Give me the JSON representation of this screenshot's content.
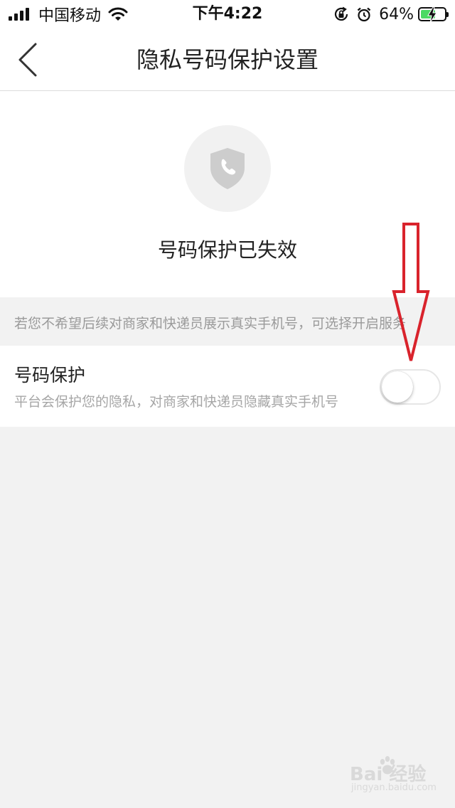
{
  "status_bar": {
    "carrier": "中国移动",
    "time": "下午4:22",
    "battery_percent": "64%",
    "battery_level": 0.64,
    "signal_bars": 4,
    "icons": [
      "signal-icon",
      "wifi-icon",
      "rotation-lock-icon",
      "alarm-icon",
      "battery-charging-icon"
    ]
  },
  "nav": {
    "title": "隐私号码保护设置",
    "back_icon": "chevron-left-icon"
  },
  "status_section": {
    "icon": "shield-phone-icon",
    "text": "号码保护已失效"
  },
  "hint": {
    "text": "若您不希望后续对商家和快递员展示真实手机号，可选择开启服务"
  },
  "setting": {
    "title": "号码保护",
    "description": "平台会保护您的隐私，对商家和快递员隐藏真实手机号",
    "toggle_on": false
  },
  "annotation": {
    "type": "red-down-arrow",
    "color": "#d9232c"
  },
  "watermark": {
    "logo": "Bai  经验",
    "sub": "jingyan.baidu.com"
  },
  "colors": {
    "background": "#f2f2f2",
    "card": "#ffffff",
    "title_text": "#222222",
    "secondary_text": "#a6a6a6",
    "icon_gray": "#cccccc",
    "battery_green": "#4cd964",
    "annotation_red": "#d9232c"
  }
}
